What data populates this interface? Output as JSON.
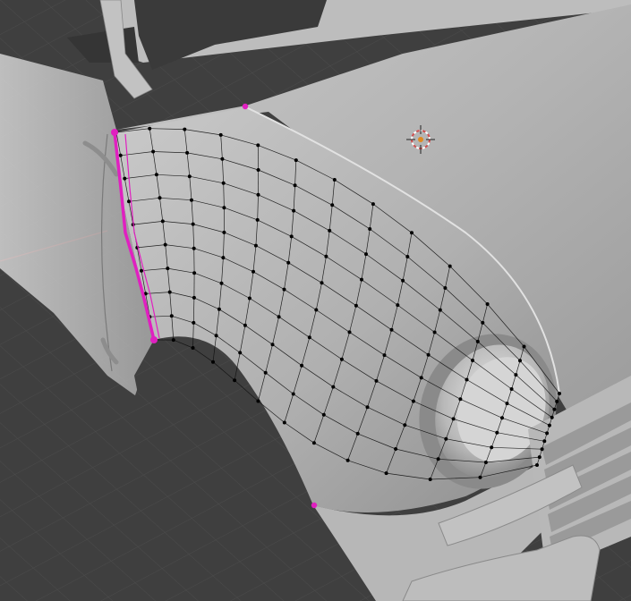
{
  "viewport": {
    "name": "3d-viewport",
    "mode": "edit-mode",
    "selection": "edge-loop-selected",
    "colors": {
      "grid_background": "#3d3d3d",
      "grid_line": "#4a4a4a",
      "floor_shadow": "#2f2f2f",
      "body_light": "#bdbdbd",
      "body_mid": "#a9a9a9",
      "body_dark": "#8d8d8d",
      "wire": "#111111",
      "vertex": "#000000",
      "selected": "#e020c0",
      "axis_x": "#b04040",
      "axis_y": "#6a9a30",
      "cursor_ring": "#d05050",
      "cursor_center": "#e08a20"
    },
    "icons": {
      "cursor": "3d-cursor-icon"
    }
  }
}
